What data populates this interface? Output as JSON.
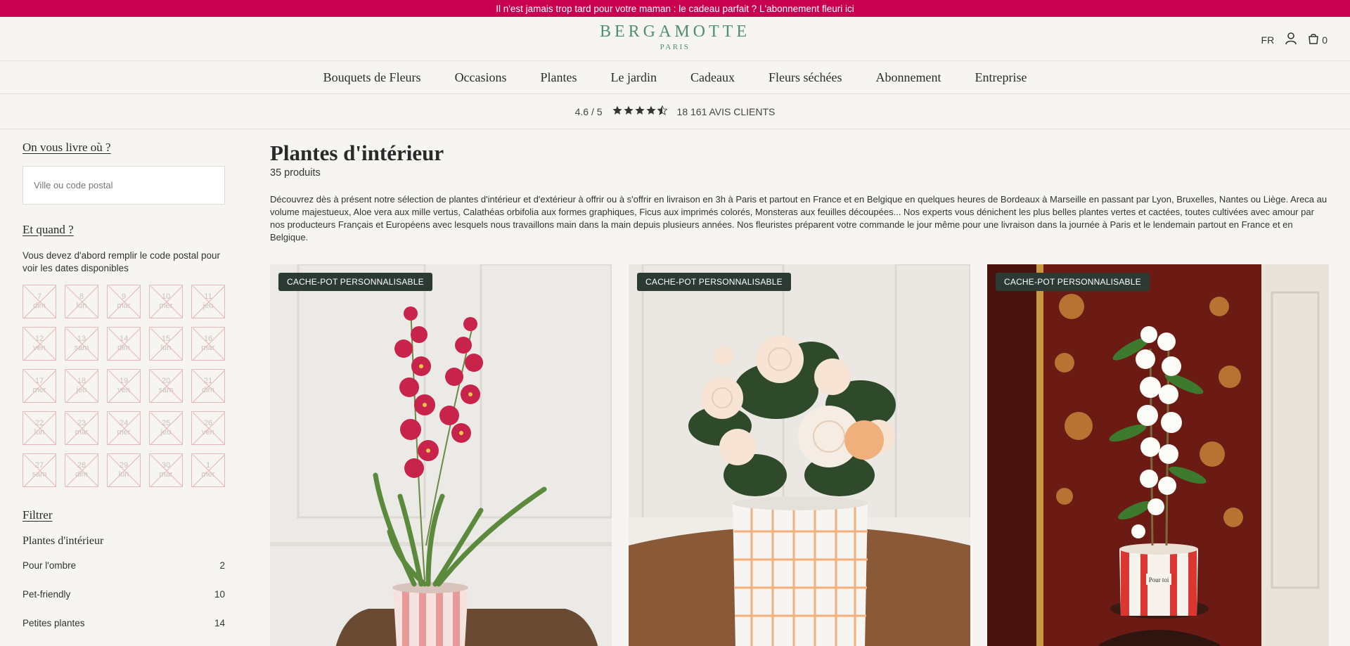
{
  "promo": "Il n'est jamais trop tard pour votre maman : le cadeau parfait ? L'abonnement fleuri ici",
  "header": {
    "logo": "BERGAMOTTE",
    "logo_sub": "PARIS",
    "lang": "FR",
    "cart_count": "0"
  },
  "nav": [
    "Bouquets de Fleurs",
    "Occasions",
    "Plantes",
    "Le jardin",
    "Cadeaux",
    "Fleurs séchées",
    "Abonnement",
    "Entreprise"
  ],
  "reviews": {
    "score": "4.6 / 5",
    "rating": 4.6,
    "count": "18 161 AVIS CLIENTS"
  },
  "sidebar": {
    "where_title": "On vous livre où ?",
    "postal_placeholder": "Ville ou code postal",
    "when_title": "Et quand ?",
    "when_note": "Vous devez d'abord remplir le code postal pour voir les dates disponibles",
    "dates": [
      {
        "day": "7",
        "wd": "dim"
      },
      {
        "day": "8",
        "wd": "lun"
      },
      {
        "day": "9",
        "wd": "mar"
      },
      {
        "day": "10",
        "wd": "mer"
      },
      {
        "day": "11",
        "wd": "jeu"
      },
      {
        "day": "12",
        "wd": "ven"
      },
      {
        "day": "13",
        "wd": "sam"
      },
      {
        "day": "14",
        "wd": "dim"
      },
      {
        "day": "15",
        "wd": "lun"
      },
      {
        "day": "16",
        "wd": "mar"
      },
      {
        "day": "17",
        "wd": "mer"
      },
      {
        "day": "18",
        "wd": "jeu"
      },
      {
        "day": "19",
        "wd": "ven"
      },
      {
        "day": "20",
        "wd": "sam"
      },
      {
        "day": "21",
        "wd": "dim"
      },
      {
        "day": "22",
        "wd": "lun"
      },
      {
        "day": "23",
        "wd": "mar"
      },
      {
        "day": "24",
        "wd": "mer"
      },
      {
        "day": "25",
        "wd": "jeu"
      },
      {
        "day": "26",
        "wd": "ven"
      },
      {
        "day": "27",
        "wd": "sam"
      },
      {
        "day": "28",
        "wd": "dim"
      },
      {
        "day": "29",
        "wd": "lun"
      },
      {
        "day": "30",
        "wd": "mar"
      },
      {
        "day": "1",
        "wd": "mer"
      }
    ],
    "filter_title": "Filtrer",
    "filter_category": "Plantes d'intérieur",
    "filters": [
      {
        "label": "Pour l'ombre",
        "count": "2"
      },
      {
        "label": "Pet-friendly",
        "count": "10"
      },
      {
        "label": "Petites plantes",
        "count": "14"
      }
    ]
  },
  "main": {
    "title": "Plantes d'intérieur",
    "count": "35 produits",
    "description": "Découvrez dès à présent notre sélection de plantes d'intérieur et d'extérieur à offrir ou à s'offrir en livraison en 3h à Paris et partout en France et en Belgique en quelques heures de Bordeaux à Marseille en passant par Lyon, Bruxelles, Nantes ou Liège. Areca au volume majestueux, Aloe vera aux mille vertus, Calathéas orbifolia aux formes graphiques, Ficus aux imprimés colorés, Monsteras aux feuilles découpées... Nos experts vous dénichent les plus belles plantes vertes et cactées, toutes cultivées avec amour par nos producteurs Français et Européens avec lesquels nous travaillons main dans la main depuis plusieurs années. Nos fleuristes préparent votre commande le jour même pour une livraison dans la journée à Paris et le lendemain partout en France et en Belgique."
  },
  "products": [
    {
      "badge": "CACHE-POT PERSONNALISABLE"
    },
    {
      "badge": "CACHE-POT PERSONNALISABLE"
    },
    {
      "badge": "CACHE-POT PERSONNALISABLE",
      "pot_label": "Pour toi"
    }
  ],
  "icons": {
    "user": "user-icon",
    "cart": "shopping-bag-icon"
  },
  "colors": {
    "promo": "#c8004f",
    "logo": "#4f8e6e",
    "badge": "#2b3a33",
    "date_border": "#e6b8b8"
  }
}
